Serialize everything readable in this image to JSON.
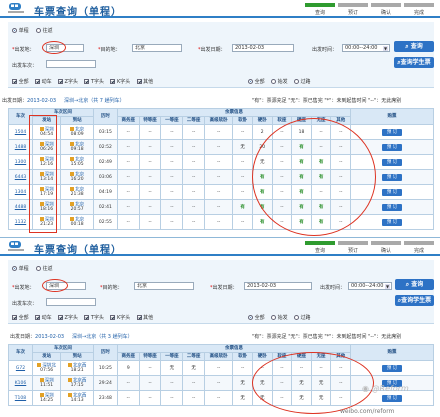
{
  "panels": [
    {
      "title": "车票查询（单程）",
      "steps": [
        "查询",
        "预订",
        "确认",
        "完成"
      ],
      "trip_type": {
        "one_way": "单程",
        "return": "往返",
        "selected": "one_way"
      },
      "from_label": "出发地：",
      "from_value": "深圳",
      "to_label": "目的地：",
      "to_value": "北京",
      "date_label": "出发日期：",
      "date_value": "2013-02-03",
      "time_label": "出发时间：",
      "time_value": "00:00--24:00",
      "train_no_label": "出发车次：",
      "train_no_value": "",
      "query_btn": "查询",
      "student_btn": "查询学生票",
      "types": [
        "全部",
        "动车",
        "Z字头",
        "T字头",
        "K字头",
        "其他"
      ],
      "scope": [
        "全部",
        "始发",
        "过路"
      ],
      "info_date_label": "出发日期：",
      "info_date": "2013-02-03",
      "info_route": "深圳→北京（共 7 趟列车）",
      "legend": "\"有\"：票源充足   \"无\"：票已售完   \"*\"：未到起售时间   \"--\"：无此席别",
      "headers": {
        "train": "车次",
        "section": "车次区间",
        "from": "发站",
        "to": "到站",
        "duration": "历时",
        "seats_group": "余票信息",
        "seats": [
          "商务座",
          "特等座",
          "一等座",
          "二等座",
          "高级软卧",
          "软卧",
          "硬卧",
          "软座",
          "硬座",
          "无座",
          "其他"
        ],
        "book": "购票"
      },
      "book_label": "预 订",
      "rows": [
        {
          "train": "1504",
          "from": "深圳",
          "from_time": "04:54",
          "to": "北京",
          "to_time": "08:09",
          "duration": "03:15",
          "seats": [
            "--",
            "--",
            "--",
            "--",
            "--",
            "--",
            "2",
            "--",
            "18",
            "--",
            "--"
          ]
        },
        {
          "train": "1488",
          "from": "深圳",
          "from_time": "06:26",
          "to": "北京",
          "to_time": "09:18",
          "duration": "02:52",
          "seats": [
            "--",
            "--",
            "--",
            "--",
            "--",
            "无",
            "20",
            "--",
            "有",
            "--",
            "--"
          ]
        },
        {
          "train": "1300",
          "from": "深圳",
          "from_time": "12:16",
          "to": "北京",
          "to_time": "15:05",
          "duration": "02:49",
          "seats": [
            "--",
            "--",
            "--",
            "--",
            "--",
            "--",
            "无",
            "--",
            "有",
            "有",
            "--"
          ]
        },
        {
          "train": "6443",
          "from": "深圳",
          "from_time": "13:14",
          "to": "北京",
          "to_time": "16:20",
          "duration": "03:06",
          "seats": [
            "--",
            "--",
            "--",
            "--",
            "--",
            "--",
            "有",
            "--",
            "有",
            "有",
            "--"
          ]
        },
        {
          "train": "1304",
          "from": "深圳",
          "from_time": "17:19",
          "to": "北京",
          "to_time": "21:38",
          "duration": "04:19",
          "seats": [
            "--",
            "--",
            "--",
            "--",
            "--",
            "--",
            "有",
            "--",
            "有",
            "--",
            "--"
          ]
        },
        {
          "train": "4488",
          "from": "深圳",
          "from_time": "18:16",
          "to": "北京",
          "to_time": "20:57",
          "duration": "02:41",
          "seats": [
            "--",
            "--",
            "--",
            "--",
            "--",
            "有",
            "有",
            "--",
            "有",
            "有",
            "--"
          ]
        },
        {
          "train": "1132",
          "from": "深圳",
          "from_time": "21:23",
          "to": "北京",
          "to_time": "00:18",
          "duration": "02:55",
          "seats": [
            "--",
            "--",
            "--",
            "--",
            "--",
            "--",
            "有",
            "--",
            "有",
            "有",
            "--"
          ]
        }
      ]
    },
    {
      "title": "车票查询（单程）",
      "steps": [
        "查询",
        "预订",
        "确认",
        "完成"
      ],
      "trip_type": {
        "one_way": "单程",
        "return": "往返",
        "selected": "one_way"
      },
      "from_label": "出发地：",
      "from_value": "深圳",
      "to_label": "目的地：",
      "to_value": "北京",
      "date_label": "出发日期：",
      "date_value": "2013-02-03",
      "time_label": "出发时间：",
      "time_value": "00:00--24:00",
      "train_no_label": "出发车次：",
      "train_no_value": "",
      "query_btn": "查询",
      "student_btn": "查询学生票",
      "types": [
        "全部",
        "动车",
        "Z字头",
        "T字头",
        "K字头",
        "其他"
      ],
      "scope": [
        "全部",
        "始发",
        "过路"
      ],
      "info_date_label": "出发日期：",
      "info_date": "2013-02-03",
      "info_route": "深圳→北京（共 3 趟列车）",
      "legend": "\"有\"：票源充足   \"无\"：票已售完   \"*\"：未到起售时间   \"--\"：无此席别",
      "headers": {
        "train": "车次",
        "section": "车次区间",
        "from": "发站",
        "to": "到站",
        "duration": "历时",
        "seats_group": "余票信息",
        "seats": [
          "商务座",
          "特等座",
          "一等座",
          "二等座",
          "高级软卧",
          "软卧",
          "硬卧",
          "软座",
          "硬座",
          "无座",
          "其他"
        ],
        "book": "购票"
      },
      "book_label": "预 订",
      "rows": [
        {
          "train": "G72",
          "from": "深圳北",
          "from_time": "07:56",
          "to": "北京西",
          "to_time": "18:21",
          "duration": "10:25",
          "seats": [
            "9",
            "--",
            "无",
            "无",
            "--",
            "--",
            "--",
            "--",
            "--",
            "--",
            "--"
          ]
        },
        {
          "train": "K106",
          "from": "深圳",
          "from_time": "11:51",
          "to": "北京西",
          "to_time": "17:15",
          "duration": "29:24",
          "seats": [
            "--",
            "--",
            "--",
            "--",
            "--",
            "无",
            "无",
            "--",
            "无",
            "无",
            "--"
          ]
        },
        {
          "train": "T108",
          "from": "深圳",
          "from_time": "14:25",
          "to": "北京西",
          "to_time": "14:13",
          "duration": "23:48",
          "seats": [
            "--",
            "--",
            "--",
            "--",
            "--",
            "无",
            "无",
            "--",
            "无",
            "无",
            "--"
          ]
        }
      ]
    }
  ],
  "watermark": {
    "brand": "新浪微博",
    "handle": "@Reform",
    "url": "weibo.com/reform"
  }
}
